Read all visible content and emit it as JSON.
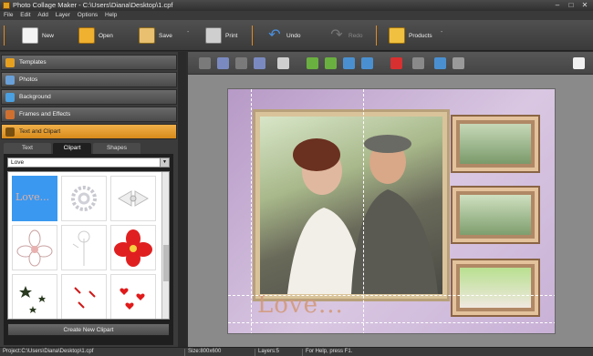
{
  "window": {
    "title": "Photo Collage Maker - C:\\Users\\Diana\\Desktop\\1.cpf",
    "minimize": "–",
    "maximize": "□",
    "close": "✕"
  },
  "menu": [
    "File",
    "Edit",
    "Add",
    "Layer",
    "Options",
    "Help"
  ],
  "toolbar": {
    "new": "New",
    "open": "Open",
    "save": "Save",
    "print": "Print",
    "undo": "Undo",
    "redo": "Redo",
    "products": "Products"
  },
  "panel": {
    "sections": {
      "templates": "Templates",
      "photos": "Photos",
      "background": "Background",
      "frames": "Frames and Effects",
      "text_clipart": "Text and Clipart"
    },
    "tabs": {
      "text": "Text",
      "clipart": "Clipart",
      "shapes": "Shapes"
    },
    "category": "Love",
    "create_button": "Create New Clipart",
    "clipart_items": [
      "Love...",
      "Pearls",
      "Bow",
      "Flower",
      "Dandelion",
      "Red flower",
      "Stars",
      "Red arrows",
      "Red hearts"
    ]
  },
  "canvas": {
    "love_text": "Love..."
  },
  "status": {
    "project": "Project:C:\\Users\\Diana\\Desktop\\1.cpf",
    "size": "Size:800x600",
    "layers": "Layers:5",
    "help": "For Help, press F1."
  },
  "colors": {
    "accent": "#e08a20",
    "active_section": "#e6a03a"
  }
}
